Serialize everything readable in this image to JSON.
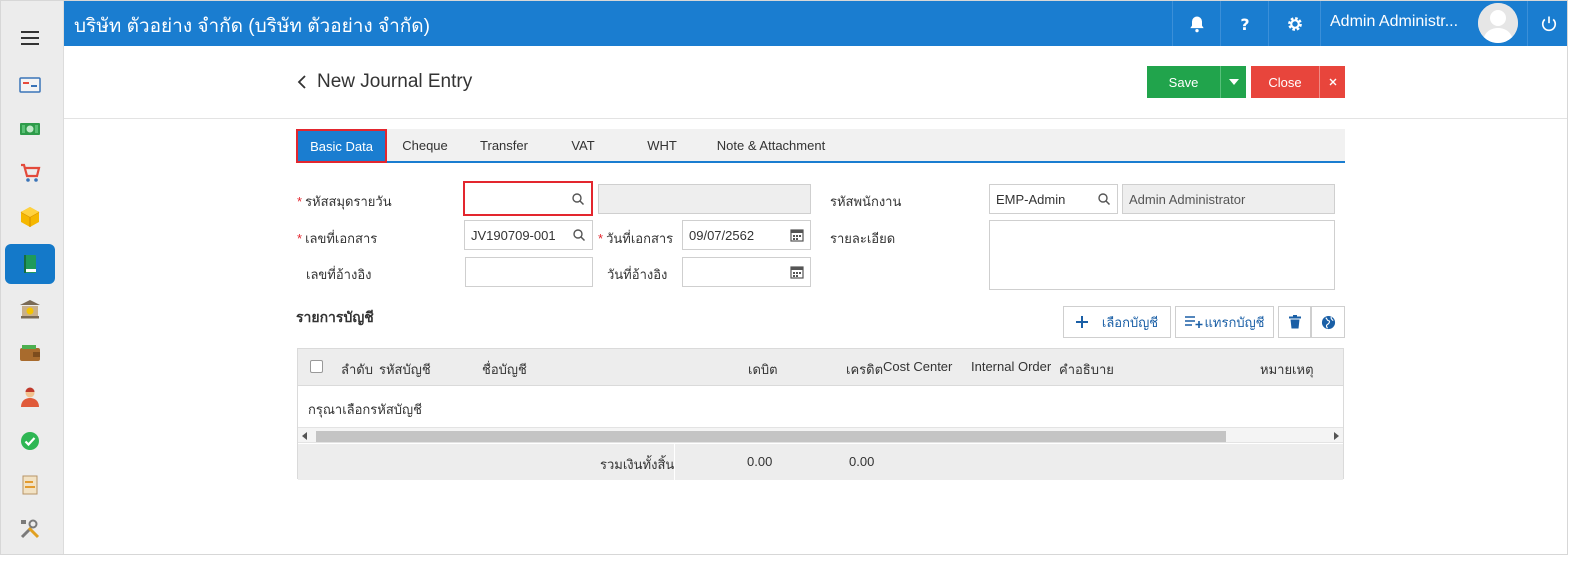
{
  "header": {
    "company": "บริษัท ตัวอย่าง จำกัด (บริษัท ตัวอย่าง จำกัด)",
    "user_name": "Admin Administr...",
    "icons": [
      "bell-icon",
      "help-icon",
      "gear-icon",
      "power-icon"
    ]
  },
  "sidebar": {
    "items": [
      {
        "name": "dashboard"
      },
      {
        "name": "finance"
      },
      {
        "name": "sales-cart"
      },
      {
        "name": "inventory"
      },
      {
        "name": "journal",
        "active": true
      },
      {
        "name": "bank"
      },
      {
        "name": "wallet"
      },
      {
        "name": "employee"
      },
      {
        "name": "approve"
      },
      {
        "name": "report"
      },
      {
        "name": "tools"
      }
    ]
  },
  "page": {
    "title": "New Journal Entry",
    "save_label": "Save",
    "close_label": "Close"
  },
  "tabs": [
    "Basic Data",
    "Cheque",
    "Transfer",
    "VAT",
    "WHT",
    "Note & Attachment"
  ],
  "form": {
    "journal_code_label": "รหัสสมุดรายวัน",
    "journal_code_value": "",
    "journal_name_value": "",
    "employee_code_label": "รหัสพนักงาน",
    "employee_code_value": "EMP-Admin",
    "employee_name_value": "Admin Administrator",
    "doc_no_label": "เลขที่เอกสาร",
    "doc_no_value": "JV190709-001",
    "doc_date_label": "วันที่เอกสาร",
    "doc_date_value": "09/07/2562",
    "detail_label": "รายละเอียด",
    "ref_no_label": "เลขที่อ้างอิง",
    "ref_no_value": "",
    "ref_date_label": "วันที่อ้างอิง",
    "ref_date_value": ""
  },
  "accounts": {
    "section_title": "รายการบัญชี",
    "select_account_label": "เลือกบัญชี",
    "insert_account_label": "แทรกบัญชี",
    "columns": {
      "seq": "ลำดับ",
      "account_code": "รหัสบัญชี",
      "account_name": "ชื่อบัญชี",
      "debit": "เดบิต",
      "credit": "เครดิต",
      "cost_center": "Cost Center",
      "internal_order": "Internal Order",
      "description": "คำอธิบาย",
      "remark": "หมายเหตุ"
    },
    "empty_message": "กรุณาเลือกรหัสบัญชี",
    "total_label": "รวมเงินทั้งสิ้น",
    "total_debit": "0.00",
    "total_credit": "0.00"
  },
  "colors": {
    "brand_blue": "#1a7dd0",
    "save_green": "#21a44c",
    "close_red": "#e8453c",
    "highlight_red": "#e3262e"
  }
}
